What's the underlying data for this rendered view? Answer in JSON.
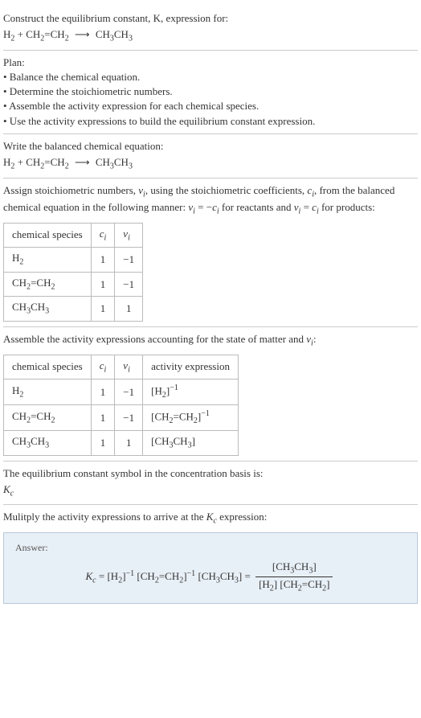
{
  "intro": {
    "line1": "Construct the equilibrium constant, K, expression for:",
    "eq_lhs1": "H",
    "eq_lhs1_sub": "2",
    "plus": " + ",
    "eq_lhs2": "CH",
    "eq_lhs2_sub1": "2",
    "eq_eq": "=CH",
    "eq_lhs2_sub2": "2",
    "arrow": "⟶",
    "eq_rhs": "CH",
    "eq_rhs_sub1": "3",
    "eq_rhs2": "CH",
    "eq_rhs_sub2": "3"
  },
  "plan": {
    "title": "Plan:",
    "b1": "• Balance the chemical equation.",
    "b2": "• Determine the stoichiometric numbers.",
    "b3": "• Assemble the activity expression for each chemical species.",
    "b4": "• Use the activity expressions to build the equilibrium constant expression."
  },
  "balanced": {
    "title": "Write the balanced chemical equation:"
  },
  "stoich": {
    "text1": "Assign stoichiometric numbers, ",
    "nu": "ν",
    "nu_sub": "i",
    "text2": ", using the stoichiometric coefficients, ",
    "c": "c",
    "c_sub": "i",
    "text3": ", from the balanced chemical equation in the following manner: ",
    "eq1": "ν",
    "eq1_sub": "i",
    "eq1_mid": " = −",
    "eq1_c": "c",
    "eq1_csub": "i",
    "text4": " for reactants and ",
    "eq2": "ν",
    "eq2_sub": "i",
    "eq2_mid": " = ",
    "eq2_c": "c",
    "eq2_csub": "i",
    "text5": " for products:",
    "table": {
      "h1": "chemical species",
      "h2_c": "c",
      "h2_sub": "i",
      "h3_c": "ν",
      "h3_sub": "i",
      "rows": [
        {
          "species_a": "H",
          "species_sub": "2",
          "species_b": "",
          "c": "1",
          "nu": "−1"
        },
        {
          "species_a": "CH",
          "species_sub1": "2",
          "species_mid": "=CH",
          "species_sub2": "2",
          "c": "1",
          "nu": "−1"
        },
        {
          "species_a": "CH",
          "species_sub1": "3",
          "species_mid": "CH",
          "species_sub2": "3",
          "c": "1",
          "nu": "1"
        }
      ]
    }
  },
  "activity": {
    "text1": "Assemble the activity expressions accounting for the state of matter and ",
    "nu": "ν",
    "nu_sub": "i",
    "text2": ":",
    "table": {
      "h1": "chemical species",
      "h2_c": "c",
      "h2_sub": "i",
      "h3_c": "ν",
      "h3_sub": "i",
      "h4": "activity expression",
      "rows": [
        {
          "c": "1",
          "nu": "−1",
          "exp_sup": "−1"
        },
        {
          "c": "1",
          "nu": "−1",
          "exp_sup": "−1"
        },
        {
          "c": "1",
          "nu": "1"
        }
      ]
    }
  },
  "kc_symbol": {
    "text": "The equilibrium constant symbol in the concentration basis is:",
    "kc": "K",
    "kc_sub": "c"
  },
  "multiply": {
    "text1": "Mulitply the activity expressions to arrive at the ",
    "kc": "K",
    "kc_sub": "c",
    "text2": " expression:"
  },
  "answer": {
    "label": "Answer:",
    "kc": "K",
    "kc_sub": "c",
    "eq": " = ",
    "exp_neg1": "−1"
  }
}
